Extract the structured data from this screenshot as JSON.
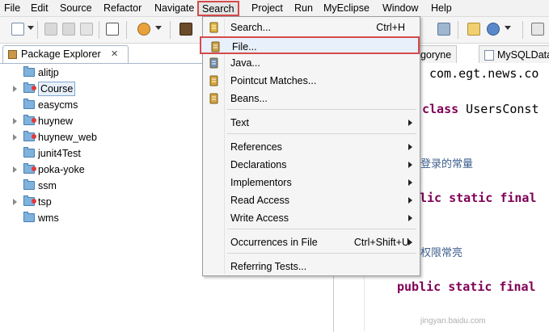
{
  "menubar": {
    "items": [
      "File",
      "Edit",
      "Source",
      "Refactor",
      "Navigate",
      "Search",
      "Project",
      "Run",
      "MyEclipse",
      "Window",
      "Help"
    ]
  },
  "package_explorer": {
    "title": "Package Explorer",
    "close_glyph": "✕",
    "projects": [
      {
        "name": "alitjp",
        "expandable": false,
        "decorated": false
      },
      {
        "name": "Course",
        "expandable": true,
        "decorated": true,
        "selected": true
      },
      {
        "name": "easycms",
        "expandable": false,
        "decorated": false
      },
      {
        "name": "huynew",
        "expandable": true,
        "decorated": true
      },
      {
        "name": "huynew_web",
        "expandable": true,
        "decorated": true
      },
      {
        "name": "junit4Test",
        "expandable": false,
        "decorated": false
      },
      {
        "name": "poka-yoke",
        "expandable": true,
        "decorated": true
      },
      {
        "name": "ssm",
        "expandable": false,
        "decorated": false
      },
      {
        "name": "tsp",
        "expandable": true,
        "decorated": true
      },
      {
        "name": "wms",
        "expandable": false,
        "decorated": false
      }
    ]
  },
  "editor": {
    "tabs": [
      "egoryne",
      "MySQLData"
    ],
    "lines": {
      "package_line": "com.egt.news.co",
      "class_kw": "class",
      "class_name": " UsersConst",
      "comment1": "登录的常量",
      "decl1_kw": "lic static final",
      "comment2": "权限常亮",
      "decl2_kw": "public static final"
    }
  },
  "search_menu": {
    "items": [
      {
        "label": "Search...",
        "accel": "Ctrl+H",
        "icon": "search-flashlight-icon",
        "submenu": false
      },
      {
        "label": "File...",
        "accel": "",
        "icon": "file-search-icon",
        "submenu": false,
        "highlighted": true
      },
      {
        "label": "Java...",
        "accel": "",
        "icon": "java-search-icon",
        "submenu": false
      },
      {
        "label": "Pointcut Matches...",
        "accel": "",
        "icon": "pointcut-icon",
        "submenu": false
      },
      {
        "label": "Beans...",
        "accel": "",
        "icon": "beans-icon",
        "submenu": false
      },
      {
        "label": "Text",
        "accel": "",
        "icon": "",
        "submenu": true
      },
      {
        "label": "References",
        "accel": "",
        "icon": "",
        "submenu": true
      },
      {
        "label": "Declarations",
        "accel": "",
        "icon": "",
        "submenu": true
      },
      {
        "label": "Implementors",
        "accel": "",
        "icon": "",
        "submenu": true
      },
      {
        "label": "Read Access",
        "accel": "",
        "icon": "",
        "submenu": true
      },
      {
        "label": "Write Access",
        "accel": "",
        "icon": "",
        "submenu": true
      },
      {
        "label": "Occurrences in File",
        "accel": "Ctrl+Shift+U",
        "icon": "",
        "submenu": true
      },
      {
        "label": "Referring Tests...",
        "accel": "",
        "icon": "",
        "submenu": false
      }
    ]
  },
  "watermark": "jingyan.baidu.com",
  "colors": {
    "highlight_border": "#d64a4a",
    "menu_bg": "#f5f5f5",
    "keyword": "#7f0055",
    "folder": "#7fb2dd"
  }
}
